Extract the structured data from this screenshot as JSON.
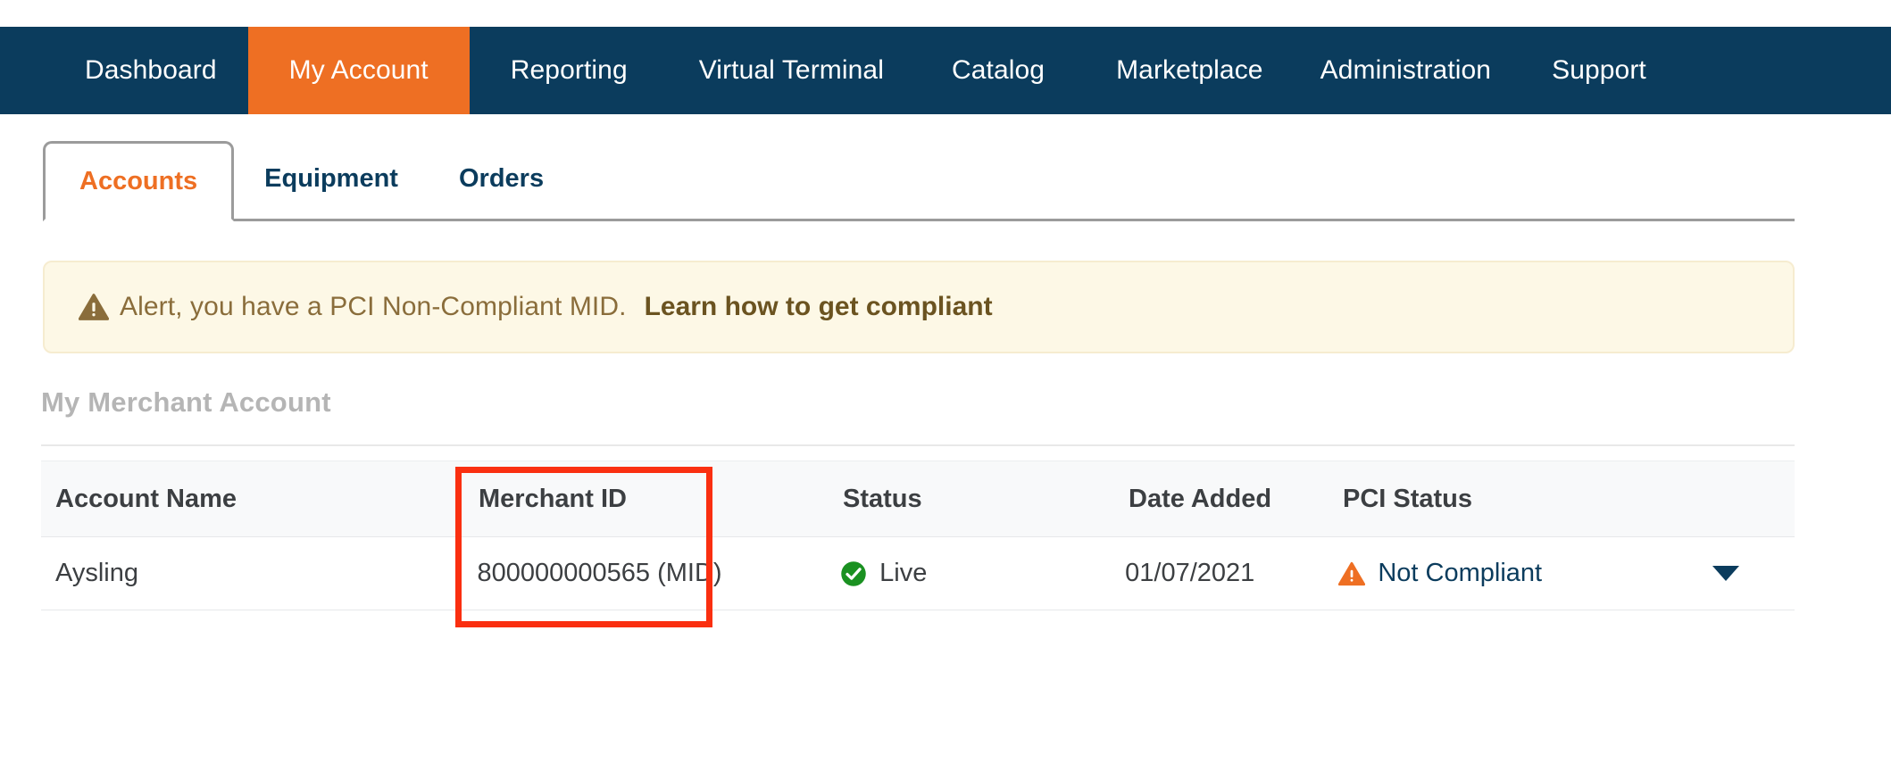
{
  "topnav": {
    "items": [
      {
        "label": "Dashboard",
        "key": "dashboard",
        "active": false
      },
      {
        "label": "My Account",
        "key": "my-account",
        "active": true
      },
      {
        "label": "Reporting",
        "key": "reporting",
        "active": false
      },
      {
        "label": "Virtual Terminal",
        "key": "virtual-terminal",
        "active": false
      },
      {
        "label": "Catalog",
        "key": "catalog",
        "active": false
      },
      {
        "label": "Marketplace",
        "key": "marketplace",
        "active": false
      },
      {
        "label": "Administration",
        "key": "administration",
        "active": false
      },
      {
        "label": "Support",
        "key": "support",
        "active": false
      }
    ],
    "background_color": "#0b3c5d",
    "active_color": "#ee6f23"
  },
  "tabs": [
    {
      "label": "Accounts",
      "active": true
    },
    {
      "label": "Equipment",
      "active": false
    },
    {
      "label": "Orders",
      "active": false
    }
  ],
  "alert": {
    "icon": "warning-triangle-icon",
    "message": "Alert, you have a PCI Non-Compliant MID.",
    "link_label": "Learn how to get compliant",
    "background_color": "#fdf8e6",
    "text_color": "#8a6d3b"
  },
  "section": {
    "title": "My Merchant Account"
  },
  "table": {
    "headers": [
      "Account Name",
      "Merchant ID",
      "Status",
      "Date Added",
      "PCI Status"
    ],
    "rows": [
      {
        "account_name": "Aysling",
        "merchant_id": "800000000565 (MID)",
        "status": "Live",
        "status_icon": "green-check-circle-icon",
        "date_added": "01/07/2021",
        "pci_status": "Not Compliant",
        "pci_icon": "orange-warning-triangle-icon",
        "row_menu_icon": "chevron-down-icon"
      }
    ]
  },
  "annotation": {
    "type": "highlight-box",
    "color": "#fa2f10",
    "target": "Merchant ID column"
  }
}
